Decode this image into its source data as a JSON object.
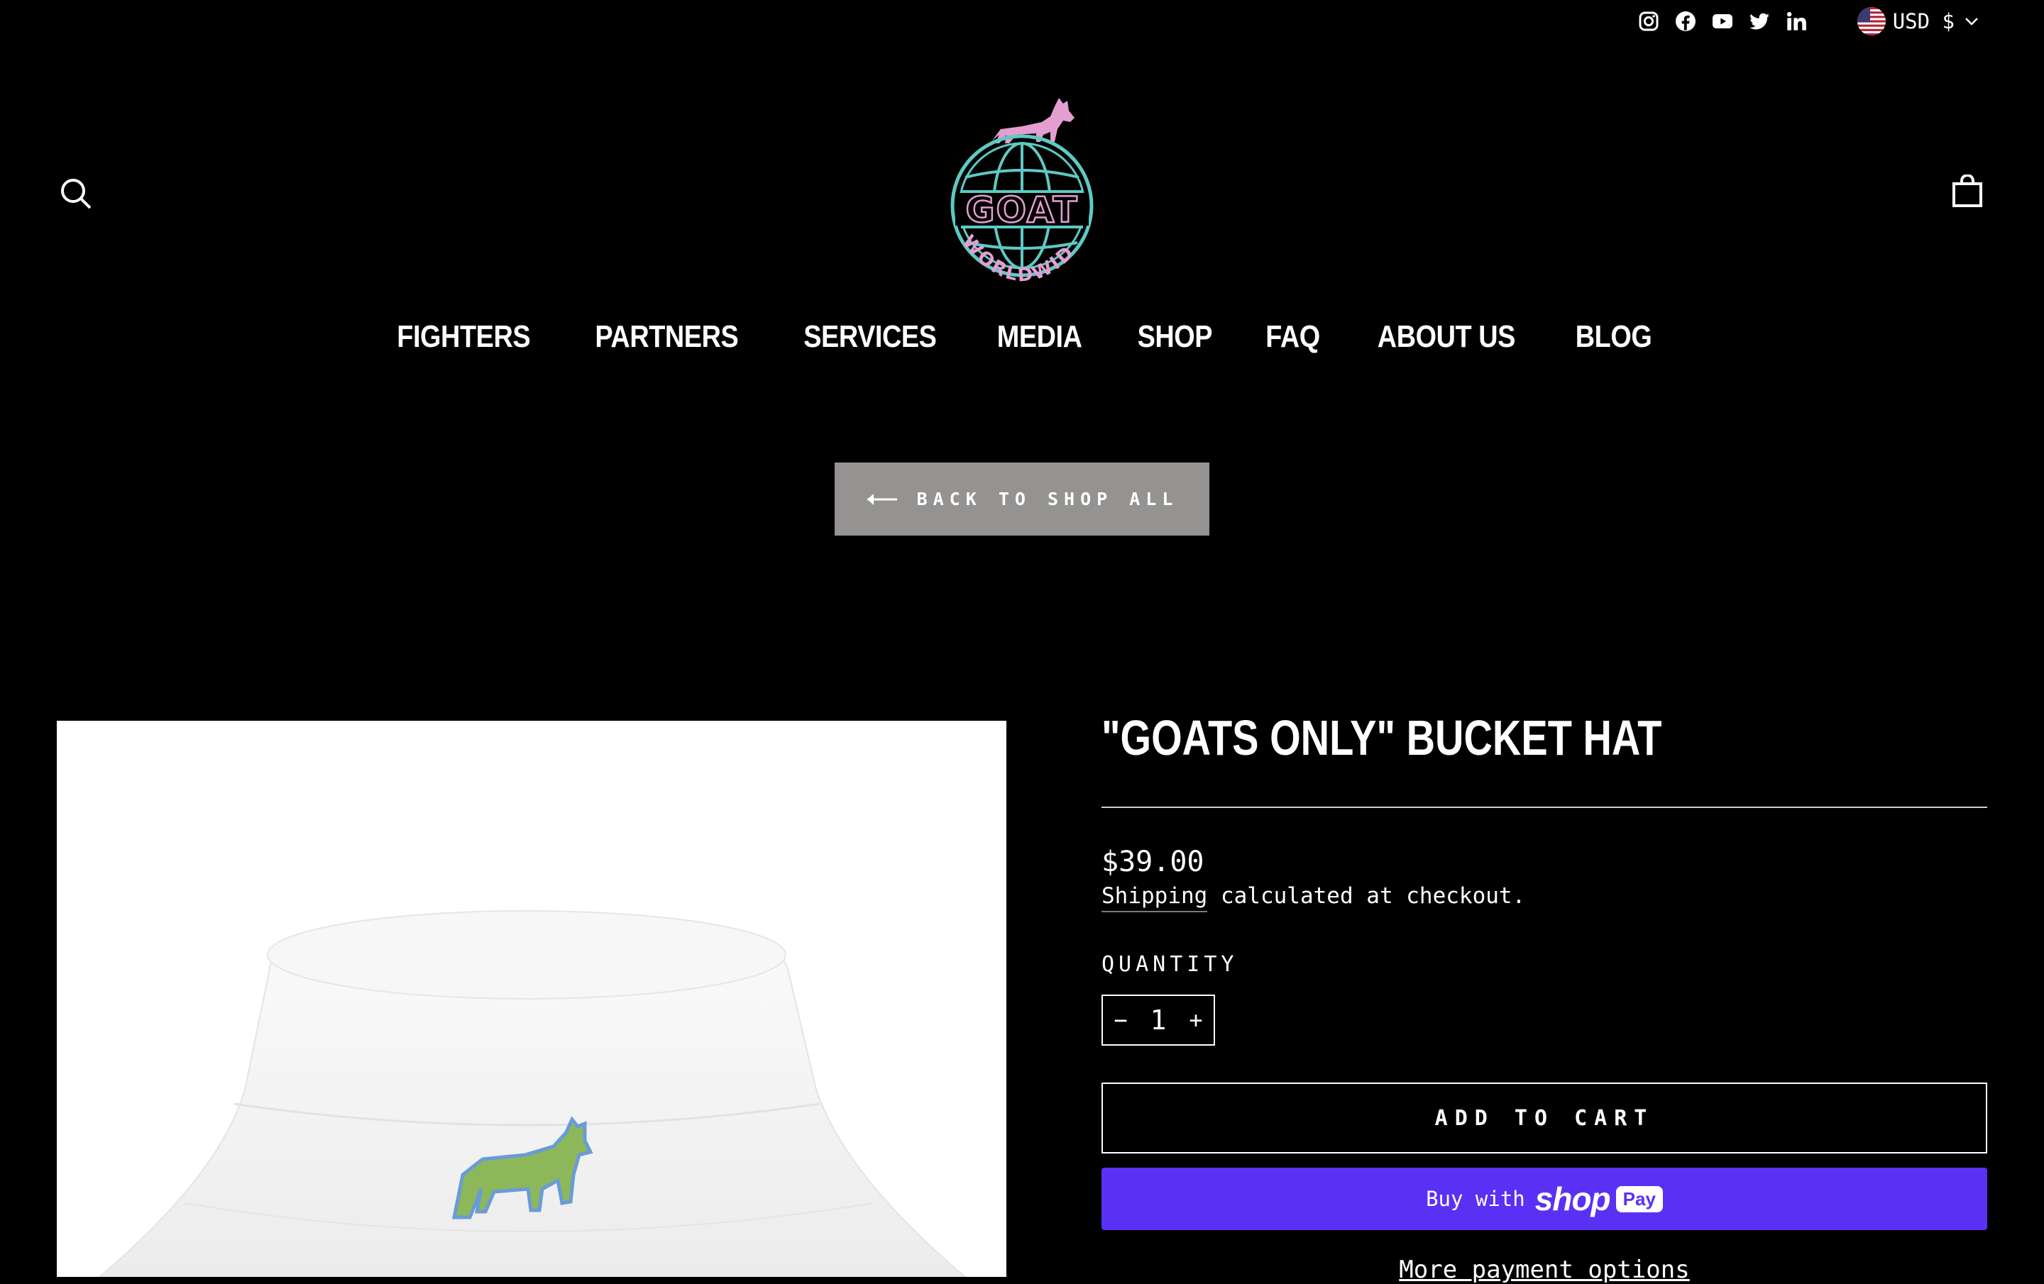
{
  "header": {
    "social": [
      "instagram",
      "facebook",
      "youtube",
      "twitter",
      "linkedin"
    ],
    "currency": "USD $",
    "logo_text": "GOAT",
    "logo_subtext": "WORLDWIDE"
  },
  "nav": {
    "items": [
      "FIGHTERS",
      "PARTNERS",
      "SERVICES",
      "MEDIA",
      "SHOP",
      "FAQ",
      "ABOUT US",
      "BLOG"
    ]
  },
  "back_button": {
    "label": "BACK TO SHOP ALL"
  },
  "product": {
    "title": "\"GOATS ONLY\" BUCKET HAT",
    "price": "$39.00",
    "shipping_link": "Shipping",
    "shipping_rest": " calculated at checkout.",
    "quantity_label": "QUANTITY",
    "quantity_value": "1",
    "add_to_cart": "ADD TO CART",
    "buy_with": "Buy with",
    "shop_word": "shop",
    "pay_word": "Pay",
    "more_payment": "More payment options"
  },
  "colors": {
    "background": "#000000",
    "back_button_bg": "#949391",
    "shop_pay_purple": "#5a31f4",
    "logo_pink": "#e59ed0",
    "logo_teal": "#5ec9c3"
  }
}
